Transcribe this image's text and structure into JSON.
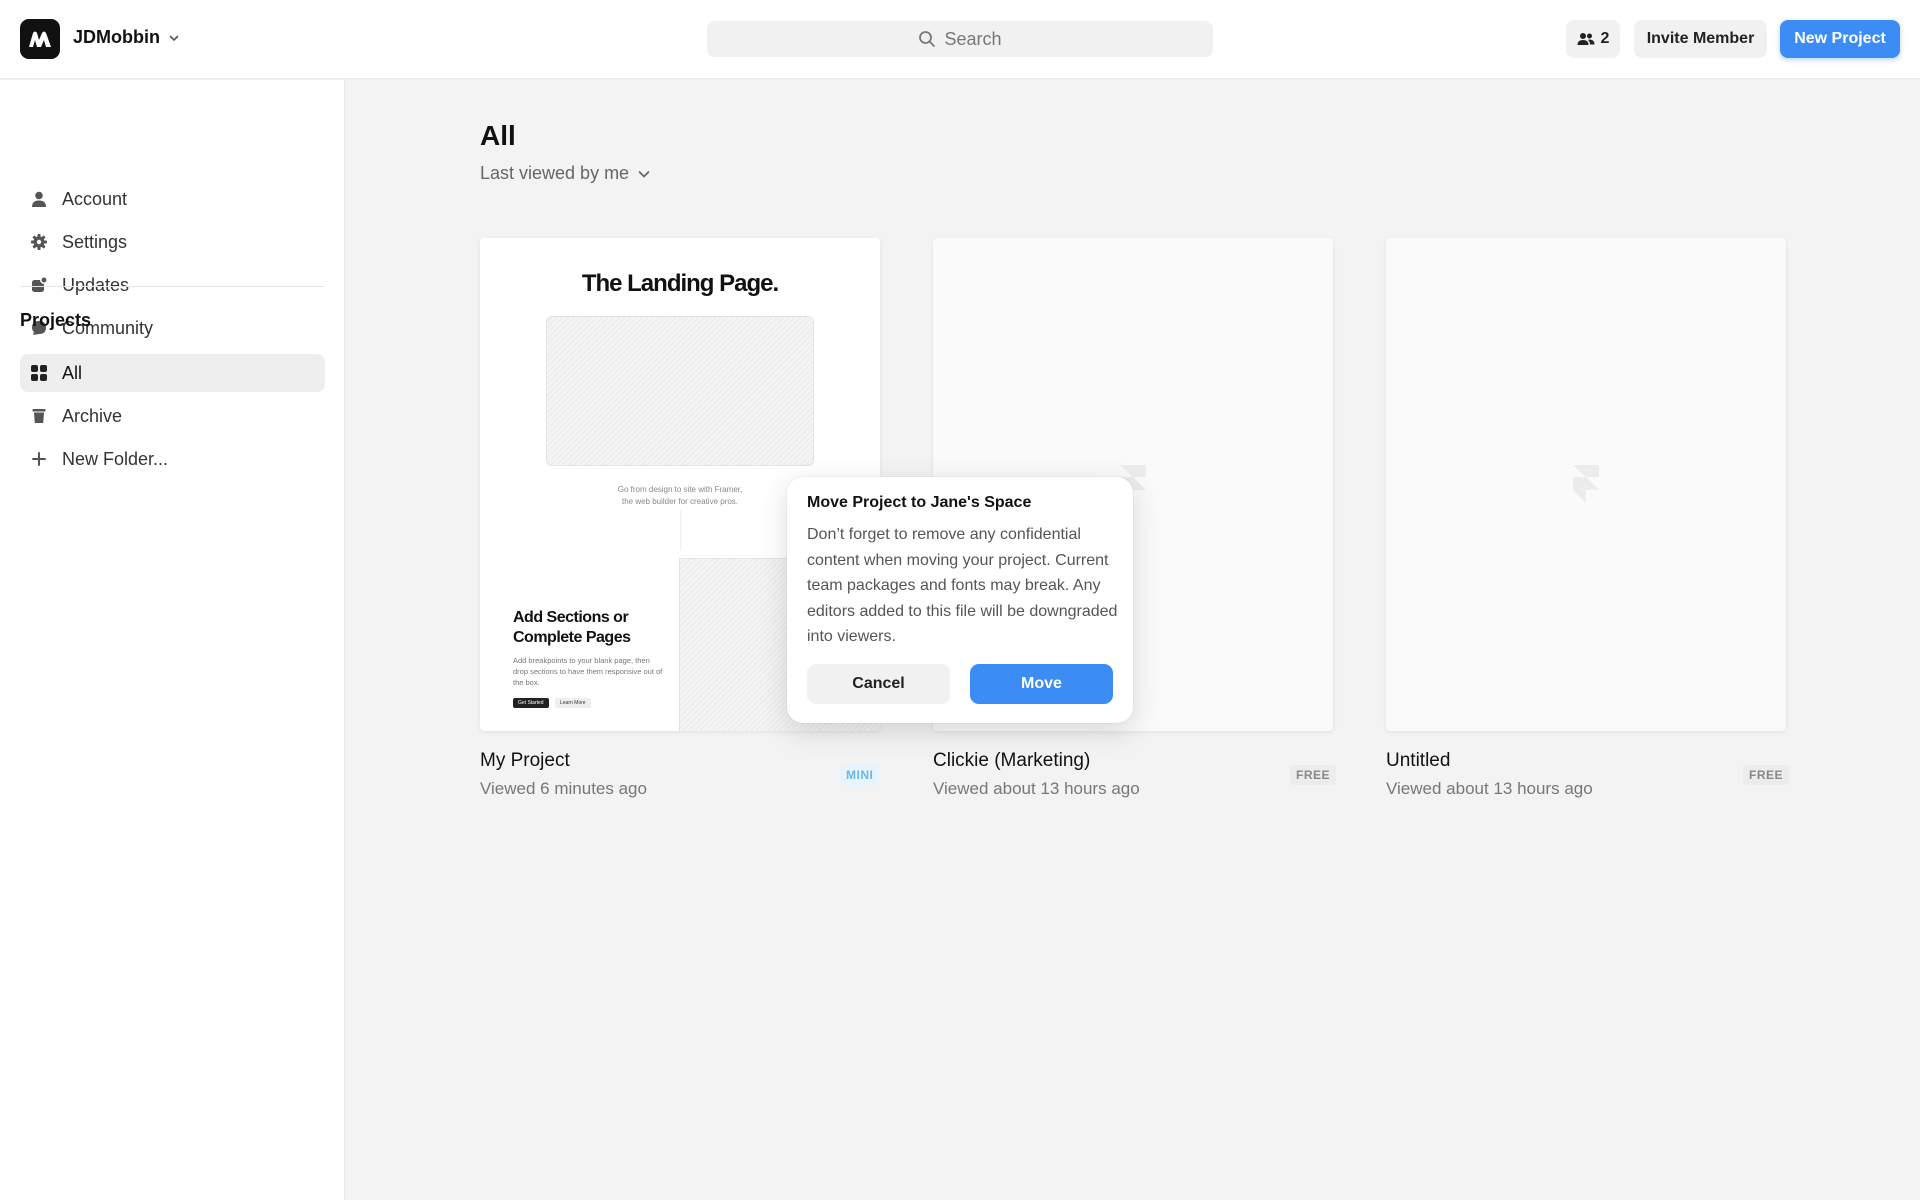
{
  "header": {
    "logo_icon": "framer-m-logo-icon",
    "workspace_name": "JDMobbin",
    "search_placeholder": "Search",
    "members_count": "2",
    "invite_label": "Invite Member",
    "new_project_label": "New Project",
    "accent": "#3b8cf5"
  },
  "sidebar": {
    "items": [
      {
        "label": "Account",
        "icon": "user-icon"
      },
      {
        "label": "Settings",
        "icon": "gear-icon"
      },
      {
        "label": "Updates",
        "icon": "updates-icon"
      },
      {
        "label": "Community",
        "icon": "chat-bubble-icon"
      }
    ],
    "projects_title": "Projects",
    "project_items": [
      {
        "label": "All",
        "icon": "grid-icon",
        "active": true
      },
      {
        "label": "Archive",
        "icon": "trash-icon"
      },
      {
        "label": "New Folder...",
        "icon": "plus-icon"
      }
    ]
  },
  "main": {
    "title": "All",
    "sort_label": "Last viewed by me",
    "projects": [
      {
        "name": "My Project",
        "viewed": "Viewed 6 minutes ago",
        "badge": "MINI"
      },
      {
        "name": "Clickie (Marketing)",
        "viewed": "Viewed about 13 hours ago",
        "badge": "FREE"
      },
      {
        "name": "Untitled",
        "viewed": "Viewed about 13 hours ago",
        "badge": "FREE"
      }
    ],
    "thumbnail": {
      "title": "The Landing Page.",
      "subtitle_line1": "Go from design to site with Framer,",
      "subtitle_line2": "the web builder for creative pros.",
      "section_title": "Add Sections or Complete Pages",
      "section_text": "Add breakpoints to your blank page, then drop sections to have them responsive out of the box.",
      "btn_primary": "Get Started",
      "btn_secondary": "Learn More"
    }
  },
  "popover": {
    "title": "Move Project to Jane's Space",
    "body": "Don’t forget to remove any confidential content when moving your project. Current team packages and fonts may break. Any editors added to this file will be downgraded into viewers.",
    "cancel_label": "Cancel",
    "move_label": "Move"
  }
}
